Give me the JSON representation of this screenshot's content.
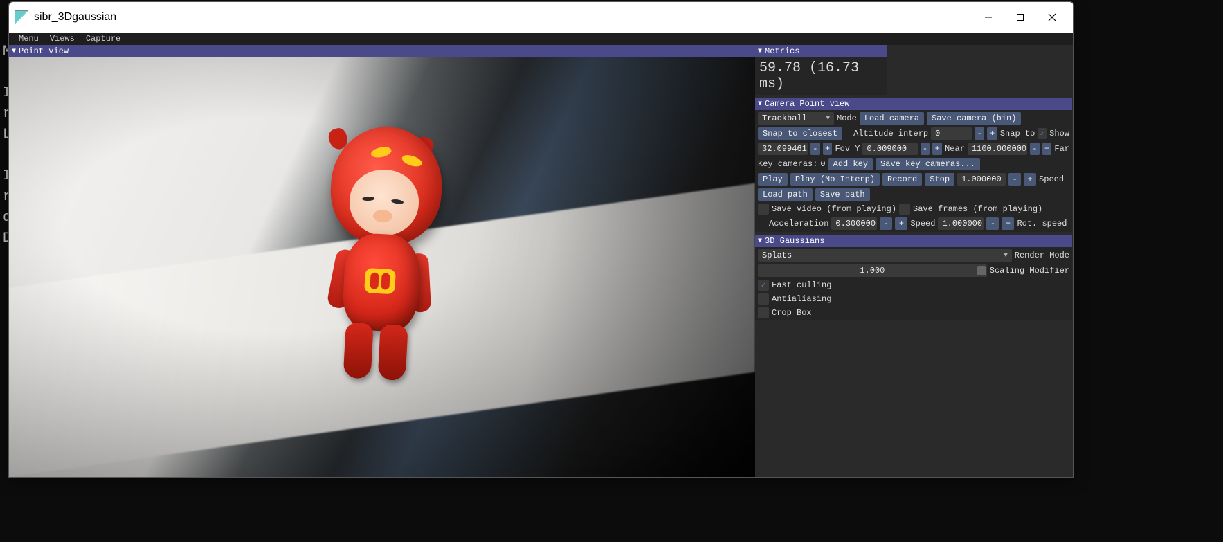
{
  "window": {
    "title": "sibr_3Dgaussian"
  },
  "menubar": {
    "items": [
      "Menu",
      "Views",
      "Capture"
    ]
  },
  "viewport": {
    "header": "Point view"
  },
  "metrics": {
    "header": "Metrics",
    "value": "59.78 (16.73 ms)"
  },
  "camera": {
    "header": "Camera Point view",
    "mode_dropdown": "Trackball",
    "mode_label": "Mode",
    "load_camera": "Load camera",
    "save_camera": "Save camera (bin)",
    "snap_to_closest": "Snap to closest",
    "altitude_label": "Altitude interp",
    "altitude_value": "0",
    "snap_to": "Snap to",
    "show_label": "Show",
    "show_checked": true,
    "fov_value": "32.099461",
    "fov_label": "Fov Y",
    "near_value": "0.009000",
    "near_label": "Near",
    "far_value": "1100.000000",
    "far_label": "Far",
    "key_cameras_label": "Key cameras:",
    "key_cameras_count": "0",
    "add_key": "Add key",
    "save_key_cams": "Save key cameras...",
    "play": "Play",
    "play_no_interp": "Play (No Interp)",
    "record": "Record",
    "stop": "Stop",
    "speed_value": "1.000000",
    "speed_label": "Speed",
    "load_path": "Load path",
    "save_path": "Save path",
    "save_video_label": "Save video (from playing)",
    "save_frames_label": "Save frames (from playing)",
    "acceleration_label": "Acceleration",
    "acceleration_value": "0.300000",
    "speed2_label": "Speed",
    "speed2_value": "1.000000",
    "rot_speed_label": "Rot. speed"
  },
  "gaussians": {
    "header": "3D Gaussians",
    "render_mode_dropdown": "Splats",
    "render_mode_label": "Render Mode",
    "scaling_value": "1.000",
    "scaling_label": "Scaling Modifier",
    "fast_culling_label": "Fast culling",
    "fast_culling_checked": true,
    "antialiasing_label": "Antialiasing",
    "antialiasing_checked": false,
    "crop_box_label": "Crop Box",
    "crop_box_checked": false
  }
}
